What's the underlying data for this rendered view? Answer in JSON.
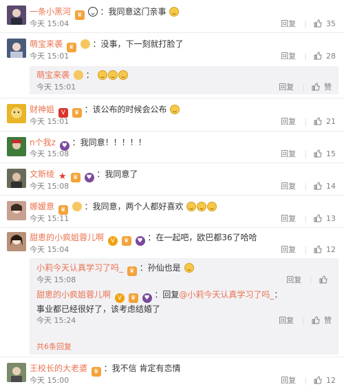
{
  "actions": {
    "reply_label": "回复",
    "sep": "|"
  },
  "comments": [
    {
      "user": "一条小黑河",
      "text": "：我同意这门亲事",
      "time": "今天 15:04",
      "likes": "35",
      "avatar_color": "#5a4a6e"
    },
    {
      "user": "萌宝来袭",
      "text": "：没事，下一刻就打脸了",
      "time": "今天 15:01",
      "likes": "28",
      "avatar_color": "#4a5a7a",
      "reply": {
        "user": "萌宝来袭",
        "text": "：",
        "time": "今天 15:01",
        "likes_label": "赞"
      }
    },
    {
      "user": "财神姐",
      "text": "：该公布的时候会公布",
      "time": "今天 15:01",
      "likes": "21",
      "avatar_color": "#e8b428"
    },
    {
      "user": "n个我z",
      "text": "：我同意！！！！！",
      "time": "今天 15:08",
      "likes": "15",
      "avatar_color": "#3e7a3a"
    },
    {
      "user": "文斯绫",
      "text": "：我同意了",
      "time": "今天 15:08",
      "likes": "14",
      "avatar_color": "#6a6a5a"
    },
    {
      "user": "娜嫒意",
      "text": "：我同意，两个人都好喜欢",
      "time": "今天 15:11",
      "likes": "13",
      "avatar_color": "#c8a090"
    },
    {
      "user": "甜恵的小疯姐蓉儿啊",
      "text": "：在一起吧，欧巴都36了哈哈",
      "time": "今天 15:04",
      "likes": "12",
      "avatar_color": "#b89078",
      "replies": [
        {
          "user": "小莉今天认真学习了吗_",
          "text": "：孙仙也是",
          "time": "今天 15:08",
          "likes_label": ""
        },
        {
          "user": "甜恵的小疯姐蓉儿啊",
          "text": "：回复",
          "mention": "@小莉今天认真学习了吗_",
          "text_after": "：事业都已经很好了，该考虑结婚了",
          "time": "今天 15:24",
          "likes_label": "赞"
        }
      ],
      "more_label": "共6条回复"
    },
    {
      "user": "王校长的大老婆",
      "text": "：我不信 肯定有恋情",
      "time": "今天 15:00",
      "likes": "12",
      "avatar_color": "#7a8a6a"
    }
  ]
}
